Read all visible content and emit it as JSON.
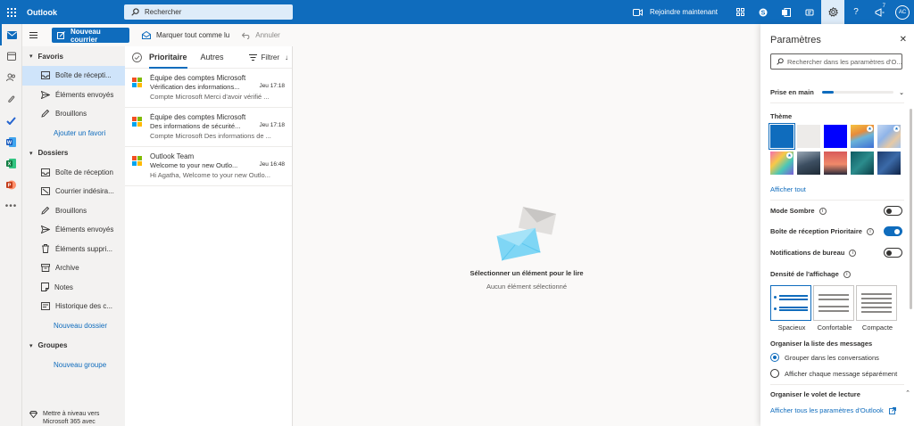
{
  "topbar": {
    "brand": "Outlook",
    "search_placeholder": "Rechercher",
    "meet_label": "Rejoindre maintenant",
    "notification_count": "7",
    "avatar_initials": "AC"
  },
  "commands": {
    "new_mail": "Nouveau courrier",
    "mark_all_read": "Marquer tout comme lu",
    "undo": "Annuler"
  },
  "folders": {
    "favorites_title": "Favoris",
    "favorites": [
      {
        "label": "Boîte de récepti...",
        "icon": "inbox-icon",
        "selected": true
      },
      {
        "label": "Éléments envoyés",
        "icon": "send-icon"
      },
      {
        "label": "Brouillons",
        "icon": "pencil-icon"
      }
    ],
    "add_favorite": "Ajouter un favori",
    "folders_title": "Dossiers",
    "items": [
      {
        "label": "Boîte de réception",
        "icon": "inbox-icon"
      },
      {
        "label": "Courrier indésira...",
        "icon": "junk-icon"
      },
      {
        "label": "Brouillons",
        "icon": "pencil-icon"
      },
      {
        "label": "Éléments envoyés",
        "icon": "send-icon"
      },
      {
        "label": "Éléments suppri...",
        "icon": "trash-icon"
      },
      {
        "label": "Archive",
        "icon": "archive-icon"
      },
      {
        "label": "Notes",
        "icon": "note-icon"
      },
      {
        "label": "Historique des c...",
        "icon": "history-icon"
      }
    ],
    "new_folder": "Nouveau dossier",
    "groups_title": "Groupes",
    "new_group": "Nouveau groupe",
    "upgrade_line1": "Mettre à niveau vers",
    "upgrade_line2": "Microsoft 365 avec"
  },
  "message_list": {
    "tab_focused": "Prioritaire",
    "tab_other": "Autres",
    "filter": "Filtrer",
    "messages": [
      {
        "from": "Équipe des comptes Microsoft",
        "subject": "Vérification des informations...",
        "time": "Jeu 17:18",
        "preview": "Compte Microsoft Merci d'avoir vérifié ..."
      },
      {
        "from": "Équipe des comptes Microsoft",
        "subject": "Des informations de sécurité...",
        "time": "Jeu 17:18",
        "preview": "Compte Microsoft Des informations de ..."
      },
      {
        "from": "Outlook Team",
        "subject": "Welcome to your new Outlo...",
        "time": "Jeu 16:48",
        "preview": "Hi Agatha, Welcome to your new Outlo..."
      }
    ]
  },
  "reading_pane": {
    "title": "Sélectionner un élément pour le lire",
    "subtitle": "Aucun élément sélectionné"
  },
  "settings": {
    "title": "Paramètres",
    "search_placeholder": "Rechercher dans les paramètres d'O...",
    "getting_started": "Prise en main",
    "getting_started_progress": 0.17,
    "theme_title": "Thème",
    "show_all": "Afficher tout",
    "dark_mode": "Mode Sombre",
    "dark_mode_on": false,
    "focused_inbox": "Boîte de réception Prioritaire",
    "focused_inbox_on": true,
    "desktop_notifications": "Notifications de bureau",
    "desktop_notifications_on": false,
    "density_title": "Densité de l'affichage",
    "density_options": [
      "Spacieux",
      "Confortable",
      "Compacte"
    ],
    "density_selected": "Spacieux",
    "organize_title": "Organiser la liste des messages",
    "organize_options": [
      "Grouper dans les conversations",
      "Afficher chaque message séparément"
    ],
    "organize_selected": "Grouper dans les conversations",
    "reading_pane_title": "Organiser le volet de lecture",
    "view_all": "Afficher tous les paramètres d'Outlook"
  },
  "colors": {
    "accent": "#0f6cbd",
    "ms_red": "#f25022",
    "ms_green": "#7fba00",
    "ms_blue": "#00a4ef",
    "ms_yellow": "#ffb900"
  }
}
